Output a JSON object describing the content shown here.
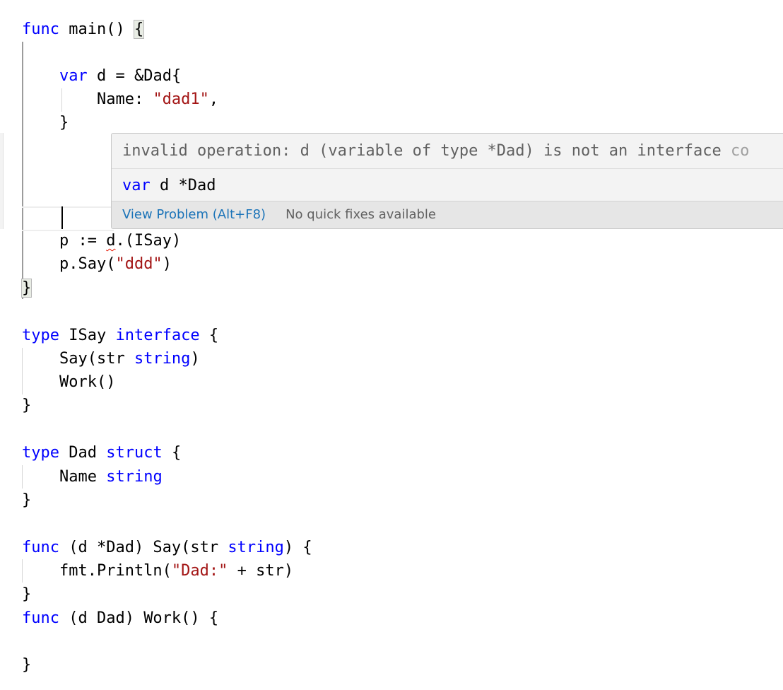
{
  "editor": {
    "language": "go",
    "lines": [
      {
        "id": "l1",
        "parts": [
          {
            "t": "func",
            "c": "kw"
          },
          {
            "t": " main() "
          },
          {
            "t": "{",
            "c": "bracket"
          }
        ]
      },
      {
        "id": "l2",
        "parts": []
      },
      {
        "id": "l3",
        "parts": [
          {
            "t": "    "
          },
          {
            "t": "var",
            "c": "kw"
          },
          {
            "t": " d = &Dad{"
          }
        ]
      },
      {
        "id": "l4",
        "parts": [
          {
            "t": "        Name: "
          },
          {
            "t": "\"dad1\"",
            "c": "str"
          },
          {
            "t": ","
          }
        ]
      },
      {
        "id": "l5",
        "parts": [
          {
            "t": "    }"
          }
        ]
      },
      {
        "id": "l10",
        "parts": [
          {
            "t": "    p := "
          },
          {
            "t": "d",
            "c": "err"
          },
          {
            "t": ".(ISay)"
          }
        ]
      },
      {
        "id": "l11",
        "parts": [
          {
            "t": "    p.Say("
          },
          {
            "t": "\"ddd\"",
            "c": "str"
          },
          {
            "t": ")"
          }
        ]
      },
      {
        "id": "l12",
        "parts": [
          {
            "t": "}",
            "c": "bracket"
          }
        ]
      },
      {
        "id": "l14",
        "parts": [
          {
            "t": "type",
            "c": "kw"
          },
          {
            "t": " ISay "
          },
          {
            "t": "interface",
            "c": "kw"
          },
          {
            "t": " {"
          }
        ]
      },
      {
        "id": "l15",
        "parts": [
          {
            "t": "    Say(str "
          },
          {
            "t": "string",
            "c": "kw"
          },
          {
            "t": ")"
          }
        ]
      },
      {
        "id": "l16",
        "parts": [
          {
            "t": "    Work()"
          }
        ]
      },
      {
        "id": "l17",
        "parts": [
          {
            "t": "}"
          }
        ]
      },
      {
        "id": "l19",
        "parts": [
          {
            "t": "type",
            "c": "kw"
          },
          {
            "t": " Dad "
          },
          {
            "t": "struct",
            "c": "kw"
          },
          {
            "t": " {"
          }
        ]
      },
      {
        "id": "l20",
        "parts": [
          {
            "t": "    Name "
          },
          {
            "t": "string",
            "c": "kw"
          }
        ]
      },
      {
        "id": "l21",
        "parts": [
          {
            "t": "}"
          }
        ]
      },
      {
        "id": "l23",
        "parts": [
          {
            "t": "func",
            "c": "kw"
          },
          {
            "t": " (d *Dad) Say(str "
          },
          {
            "t": "string",
            "c": "kw"
          },
          {
            "t": ") {"
          }
        ]
      },
      {
        "id": "l24",
        "parts": [
          {
            "t": "    fmt.Println("
          },
          {
            "t": "\"Dad:\"",
            "c": "str"
          },
          {
            "t": " + str)"
          }
        ]
      },
      {
        "id": "l25",
        "parts": [
          {
            "t": "}"
          }
        ]
      },
      {
        "id": "l26",
        "parts": [
          {
            "t": "func",
            "c": "kw"
          },
          {
            "t": " (d Dad) Work() {"
          }
        ]
      },
      {
        "id": "l27",
        "parts": []
      },
      {
        "id": "l28",
        "parts": [
          {
            "t": "}"
          }
        ]
      }
    ]
  },
  "hover": {
    "message": "invalid operation: d (variable of type *Dad) is not an interface ",
    "message_faded": "co",
    "signature_keyword": "var",
    "signature_rest": " d *Dad",
    "view_problem_label": "View Problem (Alt+F8)",
    "no_fixes_label": "No quick fixes available"
  }
}
